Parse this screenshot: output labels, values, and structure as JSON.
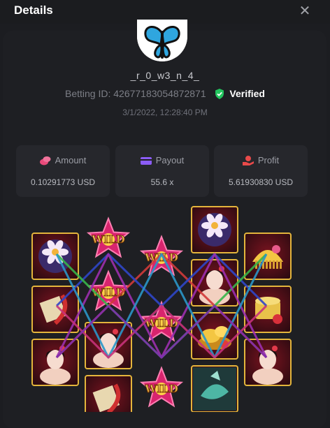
{
  "header": {
    "title": "Details",
    "close_icon": "close-icon"
  },
  "user": {
    "username": "_r_0_w3_n_4_",
    "betting_id_label": "Betting ID:",
    "betting_id": "42677183054872871",
    "verified_label": "Verified",
    "timestamp": "3/1/2022, 12:28:40 PM"
  },
  "stats": {
    "amount": {
      "label": "Amount",
      "value": "0.10291773 USD",
      "icon": "coins-icon",
      "color": "#e94a7a"
    },
    "payout": {
      "label": "Payout",
      "value": "55.6 x",
      "icon": "wallet-icon",
      "color": "#8b5cf6"
    },
    "profit": {
      "label": "Profit",
      "value": "5.61930830 USD",
      "icon": "money-hand-icon",
      "color": "#e94a4a"
    }
  },
  "board": {
    "reels": [
      [
        "lotus",
        "scroll",
        "lady"
      ],
      [
        "wild",
        "wild",
        "lady",
        "scroll"
      ],
      [
        "wild",
        "wild",
        "wild"
      ],
      [
        "lotus",
        "lady",
        "gold",
        "fish"
      ],
      [
        "comb",
        "drum",
        "lady"
      ]
    ],
    "wild_label": "WILD",
    "paylines": [
      {
        "color": "#d03a3a",
        "points": [
          [
            2,
            0
          ],
          [
            1,
            1
          ],
          [
            0,
            2
          ],
          [
            1,
            3
          ],
          [
            2,
            4
          ]
        ]
      },
      {
        "color": "#2f46c8",
        "points": [
          [
            1,
            0
          ],
          [
            0,
            1
          ],
          [
            1,
            2
          ],
          [
            0,
            3
          ],
          [
            1,
            4
          ]
        ]
      },
      {
        "color": "#36b54a",
        "points": [
          [
            0,
            0
          ],
          [
            1,
            1
          ],
          [
            2,
            2
          ],
          [
            1,
            3
          ],
          [
            0,
            4
          ]
        ]
      },
      {
        "color": "#9b2fae",
        "points": [
          [
            2,
            0
          ],
          [
            0,
            1
          ],
          [
            2,
            2
          ],
          [
            0,
            3
          ],
          [
            2,
            4
          ]
        ]
      },
      {
        "color": "#2a96c8",
        "points": [
          [
            0,
            0
          ],
          [
            2,
            1
          ],
          [
            0,
            2
          ],
          [
            2,
            3
          ],
          [
            0,
            4
          ]
        ]
      },
      {
        "color": "#c7327a",
        "points": [
          [
            1,
            0
          ],
          [
            2,
            1
          ],
          [
            1,
            2
          ],
          [
            2,
            3
          ],
          [
            1,
            4
          ]
        ]
      },
      {
        "color": "#7d2fae",
        "points": [
          [
            2,
            0
          ],
          [
            1,
            1
          ],
          [
            2,
            2
          ],
          [
            1,
            3
          ],
          [
            2,
            4
          ]
        ]
      }
    ]
  }
}
